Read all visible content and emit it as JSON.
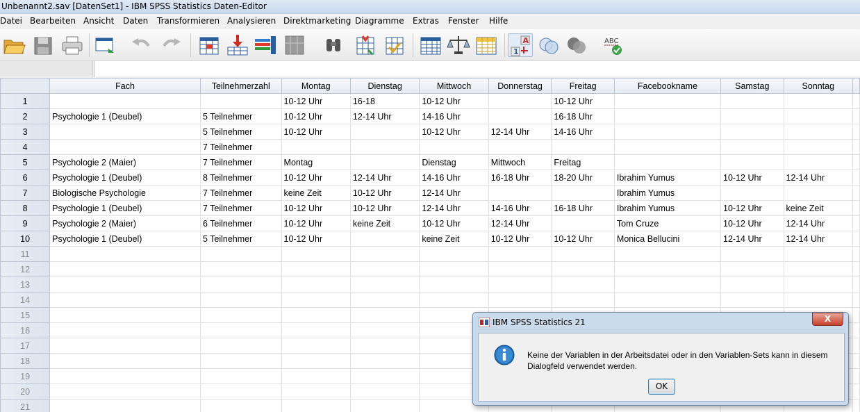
{
  "window": {
    "title": "Unbenannt2.sav [DatenSet1] - IBM SPSS Statistics Daten-Editor"
  },
  "menu": [
    "Datei",
    "Bearbeiten",
    "Ansicht",
    "Daten",
    "Transformieren",
    "Analysieren",
    "Direktmarketing",
    "Diagramme",
    "Extras",
    "Fenster",
    "Hilfe"
  ],
  "toolbar": {
    "icons": [
      "open-folder-icon",
      "save-icon",
      "print-icon",
      "dialog-recall-icon",
      "undo-icon",
      "redo-icon",
      "goto-case-icon",
      "goto-variable-icon",
      "variables-icon",
      "run-descriptives-icon",
      "find-icon",
      "insert-cases-icon",
      "insert-variable-icon",
      "split-file-icon",
      "weight-cases-icon",
      "select-cases-icon",
      "value-labels-icon",
      "use-variable-sets-icon",
      "show-all-variables-icon",
      "spell-check-icon"
    ]
  },
  "grid": {
    "columns": [
      "Fach",
      "Teilnehmerzahl",
      "Montag",
      "Dienstag",
      "Mittwoch",
      "Donnerstag",
      "Freitag",
      "Facebookname",
      "Samstag",
      "Sonntag"
    ],
    "rows": [
      {
        "n": "1",
        "cells": [
          "",
          "",
          "10-12 Uhr",
          "16-18",
          "10-12 Uhr",
          "",
          "10-12 Uhr",
          "",
          "",
          ""
        ]
      },
      {
        "n": "2",
        "cells": [
          "Psychologie 1 (Deubel)",
          "5 Teilnehmer",
          "10-12 Uhr",
          "12-14 Uhr",
          "14-16 Uhr",
          "",
          "16-18 Uhr",
          "",
          "",
          ""
        ]
      },
      {
        "n": "3",
        "cells": [
          "",
          "5 Teilnehmer",
          "10-12 Uhr",
          "",
          "10-12 Uhr",
          "12-14 Uhr",
          "14-16 Uhr",
          "",
          "",
          ""
        ]
      },
      {
        "n": "4",
        "cells": [
          "",
          "7 Teilnehmer",
          "",
          "",
          "",
          "",
          "",
          "",
          "",
          ""
        ]
      },
      {
        "n": "5",
        "cells": [
          "Psychologie 2 (Maier)",
          "7 Teilnehmer",
          "Montag",
          "",
          "Dienstag",
          "Mittwoch",
          "Freitag",
          "",
          "",
          ""
        ]
      },
      {
        "n": "6",
        "cells": [
          "Psychologie 1 (Deubel)",
          "8 Teilnehmer",
          "10-12 Uhr",
          "12-14 Uhr",
          "14-16 Uhr",
          "16-18 Uhr",
          "18-20 Uhr",
          "Ibrahim Yumus",
          "10-12 Uhr",
          "12-14 Uhr"
        ]
      },
      {
        "n": "7",
        "cells": [
          "Biologische Psychologie",
          "7 Teilnehmer",
          "keine Zeit",
          "10-12 Uhr",
          "12-14 Uhr",
          "",
          "",
          "Ibrahim Yumus",
          "",
          ""
        ]
      },
      {
        "n": "8",
        "cells": [
          "Psychologie 1 (Deubel)",
          "7 Teilnehmer",
          "10-12 Uhr",
          "10-12 Uhr",
          "12-14 Uhr",
          "14-16 Uhr",
          "16-18 Uhr",
          "Ibrahim Yumus",
          "10-12 Uhr",
          "keine Zeit"
        ]
      },
      {
        "n": "9",
        "cells": [
          "Psychologie 2 (Maier)",
          "6 Teilnehmer",
          "10-12 Uhr",
          "keine Zeit",
          "10-12 Uhr",
          "12-14 Uhr",
          "",
          "Tom Cruze",
          "10-12 Uhr",
          "12-14 Uhr"
        ]
      },
      {
        "n": "10",
        "cells": [
          "Psychologie 1 (Deubel)",
          "5 Teilnehmer",
          "10-12 Uhr",
          "",
          "keine Zeit",
          "10-12 Uhr",
          "10-12 Uhr",
          "Monica Bellucini",
          "12-14 Uhr",
          "12-14 Uhr"
        ]
      },
      {
        "n": "11",
        "cells": [
          "",
          "",
          "",
          "",
          "",
          "",
          "",
          "",
          "",
          ""
        ]
      },
      {
        "n": "12",
        "cells": [
          "",
          "",
          "",
          "",
          "",
          "",
          "",
          "",
          "",
          ""
        ]
      },
      {
        "n": "13",
        "cells": [
          "",
          "",
          "",
          "",
          "",
          "",
          "",
          "",
          "",
          ""
        ]
      },
      {
        "n": "14",
        "cells": [
          "",
          "",
          "",
          "",
          "",
          "",
          "",
          "",
          "",
          ""
        ]
      },
      {
        "n": "15",
        "cells": [
          "",
          "",
          "",
          "",
          "",
          "",
          "",
          "",
          "",
          ""
        ]
      },
      {
        "n": "16",
        "cells": [
          "",
          "",
          "",
          "",
          "",
          "",
          "",
          "",
          "",
          ""
        ]
      },
      {
        "n": "17",
        "cells": [
          "",
          "",
          "",
          "",
          "",
          "",
          "",
          "",
          "",
          ""
        ]
      },
      {
        "n": "18",
        "cells": [
          "",
          "",
          "",
          "",
          "",
          "",
          "",
          "",
          "",
          ""
        ]
      },
      {
        "n": "19",
        "cells": [
          "",
          "",
          "",
          "",
          "",
          "",
          "",
          "",
          "",
          ""
        ]
      },
      {
        "n": "20",
        "cells": [
          "",
          "",
          "",
          "",
          "",
          "",
          "",
          "",
          "",
          ""
        ]
      },
      {
        "n": "21",
        "cells": [
          "",
          "",
          "",
          "",
          "",
          "",
          "",
          "",
          "",
          ""
        ]
      }
    ]
  },
  "dialog": {
    "title": "IBM SPSS Statistics 21",
    "message": "Keine der Variablen in der Arbeitsdatei oder in den Variablen-Sets kann in diesem Dialogfeld verwendet werden.",
    "ok_label": "OK",
    "close_label": "X",
    "icon": "info-icon"
  }
}
